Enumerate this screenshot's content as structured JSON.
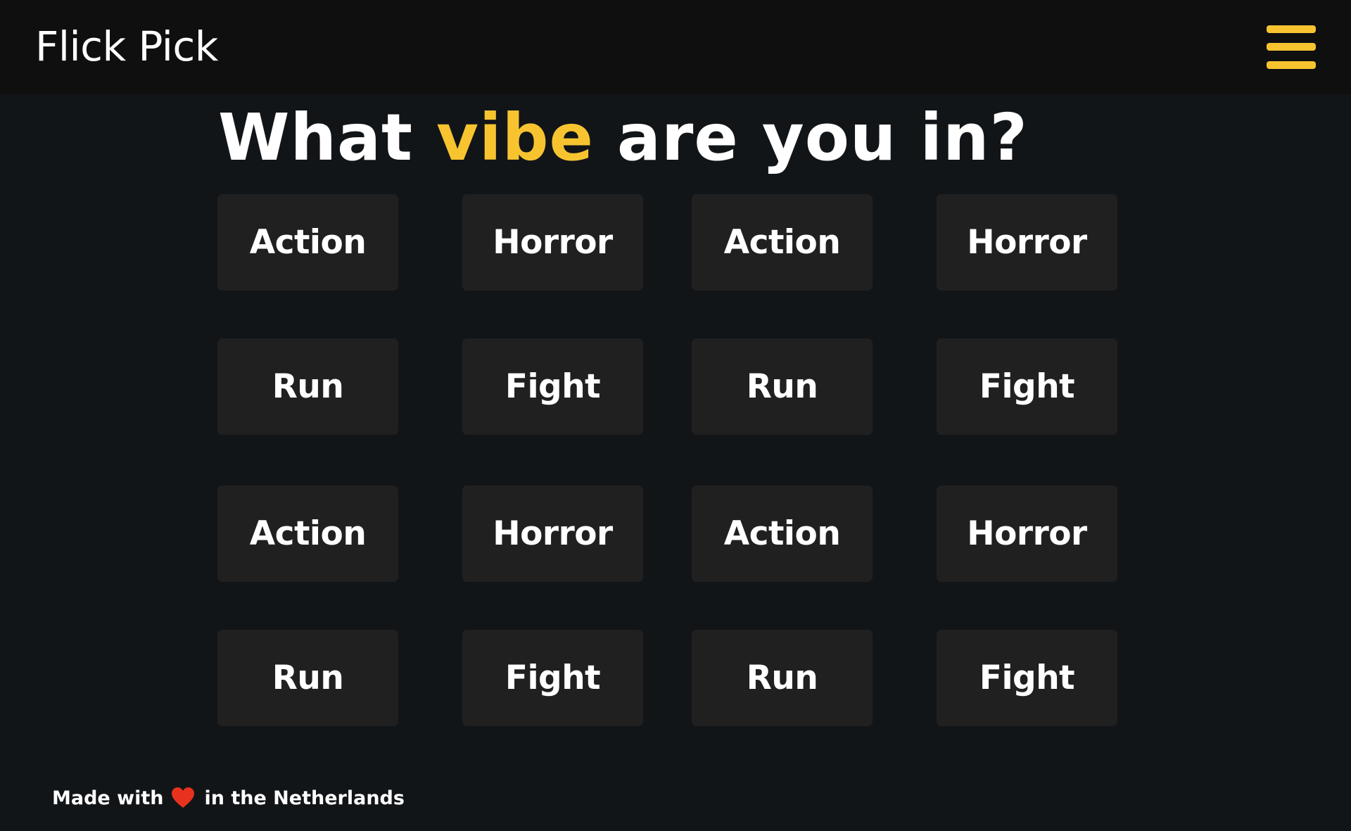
{
  "app": {
    "title": "Flick Pick"
  },
  "header": {
    "menu_icon": "hamburger-menu-icon",
    "menu_color": "#f7c430"
  },
  "headline": {
    "prefix": "What ",
    "highlight": "vibe",
    "suffix": " are you in?",
    "highlight_color": "#f7c430"
  },
  "genres": {
    "rows": [
      [
        "Action",
        "Horror",
        "Action",
        "Horror"
      ],
      [
        "Run",
        "Fight",
        "Run",
        "Fight"
      ],
      [
        "Action",
        "Horror",
        "Action",
        "Horror"
      ],
      [
        "Run",
        "Fight",
        "Run",
        "Fight"
      ]
    ]
  },
  "footer": {
    "before": "Made with",
    "heart_icon": "heart-icon",
    "heart_color": "#e8321e",
    "after": "in the Netherlands"
  },
  "colors": {
    "background": "#121518",
    "header_background": "#0f0f10",
    "tile_background": "#202021",
    "text": "#ffffff"
  }
}
